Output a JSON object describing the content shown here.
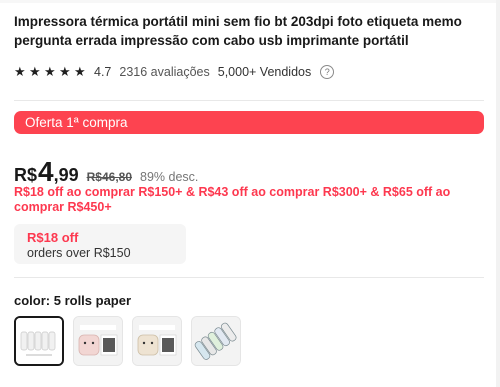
{
  "product": {
    "title": "Impressora térmica portátil mini sem fio bt 203dpi foto etiqueta memo pergunta errada impressão com cabo usb imprimante portátil",
    "rating": "4.7",
    "reviews": "2316 avaliações",
    "sold": "5,000+ Vendidos",
    "stars": 5
  },
  "promo": {
    "label": "Oferta 1ª compra"
  },
  "price": {
    "currency": "R$",
    "integer": "4",
    "decimal": ",99",
    "original": "R$46,80",
    "discount": "89% desc."
  },
  "coupons": {
    "text": "R$18 off ao comprar R$150+ & R$43 off ao comprar R$300+ & R$65 off ao comprar R$450+",
    "box_amount": "R$18 off",
    "box_condition": "orders over R$150"
  },
  "variant_section": {
    "label": "color: 5 rolls paper",
    "options": [
      {
        "name": "5 rolls paper",
        "selected": true
      },
      {
        "name": "printer-pink",
        "selected": false
      },
      {
        "name": "printer-beige",
        "selected": false
      },
      {
        "name": "paper rolls assorted",
        "selected": false
      }
    ]
  },
  "colors": {
    "promo": "#fd4350",
    "coupon": "#fd384f"
  }
}
